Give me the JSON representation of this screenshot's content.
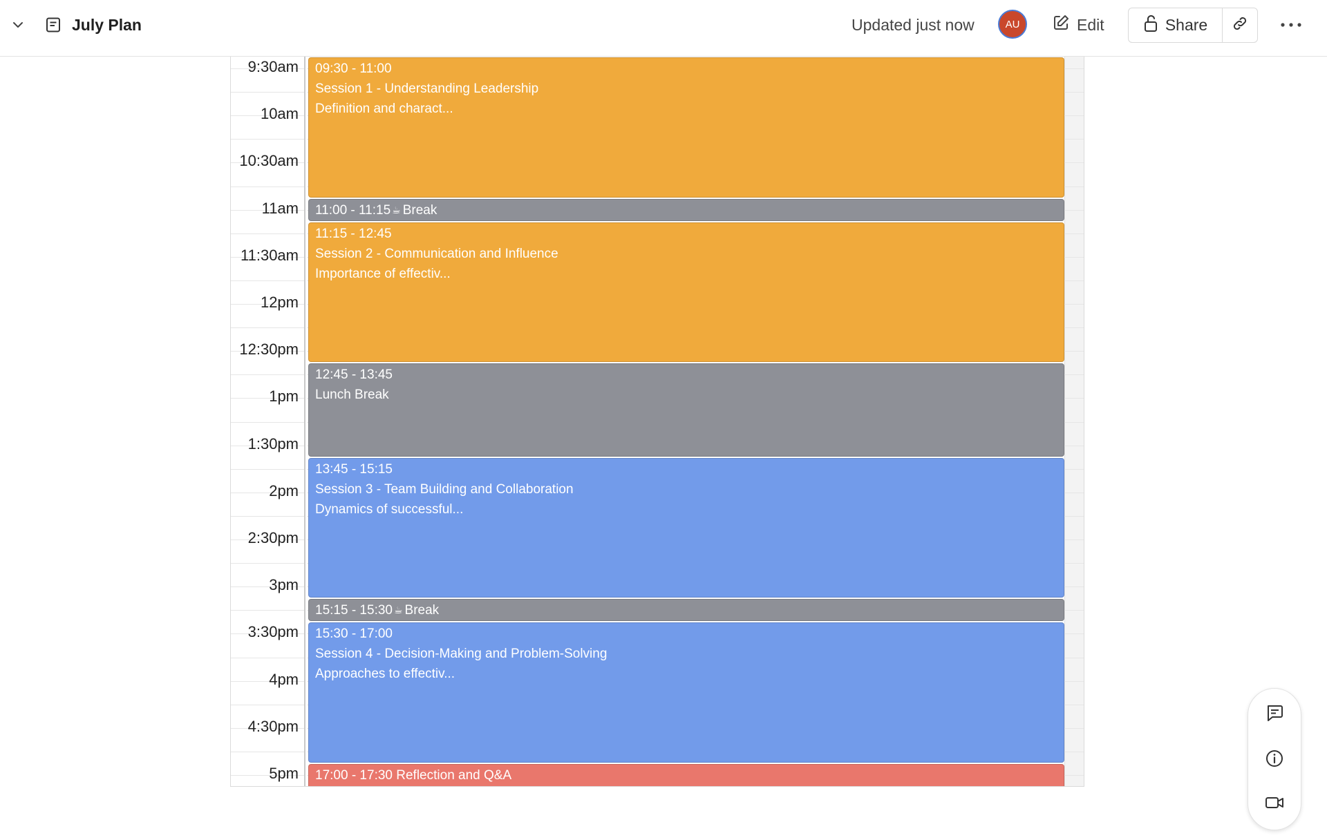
{
  "header": {
    "title": "July Plan",
    "updated": "Updated just now",
    "avatar_initials": "AU",
    "edit_label": "Edit",
    "share_label": "Share"
  },
  "calendar": {
    "time_labels": [
      "9:30am",
      "10am",
      "10:30am",
      "11am",
      "11:30am",
      "12pm",
      "12:30pm",
      "1pm",
      "1:30pm",
      "2pm",
      "2:30pm",
      "3pm",
      "3:30pm",
      "4pm",
      "4:30pm",
      "5pm"
    ],
    "events": [
      {
        "time": "09:30 - 11:00",
        "title": "Session 1 - Understanding Leadership",
        "desc": "Definition and charact...",
        "color": "#f0aa3c",
        "start": "09:30",
        "end": "11:00",
        "inline": false
      },
      {
        "time": "11:00 - 11:15",
        "title": "Break",
        "desc": "",
        "color": "#8e9097",
        "start": "11:00",
        "end": "11:15",
        "inline": true,
        "icon": "coffee-icon"
      },
      {
        "time": "11:15 - 12:45",
        "title": "Session 2 - Communication and Influence",
        "desc": "Importance of effectiv...",
        "color": "#f0aa3c",
        "start": "11:15",
        "end": "12:45",
        "inline": false
      },
      {
        "time": "12:45 - 13:45",
        "title": "Lunch Break",
        "desc": "",
        "color": "#8e9097",
        "start": "12:45",
        "end": "13:45",
        "inline": false
      },
      {
        "time": "13:45 - 15:15",
        "title": "Session 3 - Team Building and Collaboration",
        "desc": "Dynamics of successful...",
        "color": "#729bea",
        "start": "13:45",
        "end": "15:15",
        "inline": false
      },
      {
        "time": "15:15 - 15:30",
        "title": "Break",
        "desc": "",
        "color": "#8e9097",
        "start": "15:15",
        "end": "15:30",
        "inline": true,
        "icon": "coffee-icon"
      },
      {
        "time": "15:30 - 17:00",
        "title": "Session 4 - Decision-Making and Problem-Solving",
        "desc": "Approaches to effectiv...",
        "color": "#729bea",
        "start": "15:30",
        "end": "17:00",
        "inline": false
      },
      {
        "time": "17:00 - 17:30",
        "title": "Reflection and Q&A",
        "desc": "",
        "color": "#e9776c",
        "start": "17:00",
        "end": "17:30",
        "inline": true
      }
    ]
  },
  "side_panel": {
    "buttons": [
      "comment-icon",
      "info-icon",
      "video-icon"
    ]
  }
}
